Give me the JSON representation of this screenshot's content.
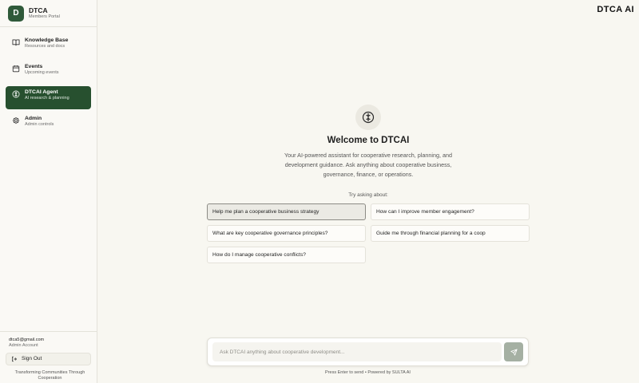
{
  "brand": {
    "logo_letter": "D",
    "title": "DTCA",
    "subtitle": "Members Portal"
  },
  "header": {
    "title": "DTCA AI"
  },
  "nav": {
    "items": [
      {
        "label": "Knowledge Base",
        "desc": "Resources and docs",
        "icon": "book-icon"
      },
      {
        "label": "Events",
        "desc": "Upcoming events",
        "icon": "calendar-icon"
      },
      {
        "label": "DTCAI Agent",
        "desc": "AI research & planning",
        "icon": "brain-icon",
        "active": true
      },
      {
        "label": "Admin",
        "desc": "Admin controls",
        "icon": "gear-icon"
      }
    ]
  },
  "account": {
    "email": "dtca5@gmail.com",
    "role": "Admin Account",
    "signout_label": "Sign Out"
  },
  "tagline": "Transforming Communities Through Cooperation",
  "welcome": {
    "title": "Welcome to DTCAI",
    "description": "Your AI-powered assistant for cooperative research, planning, and development guidance. Ask anything about cooperative business, governance, finance, or operations.",
    "try_label": "Try asking about:"
  },
  "suggestions": [
    "Help me plan a cooperative business strategy",
    "How can I improve member engagement?",
    "What are key cooperative governance principles?",
    "Guide me through financial planning for a coop",
    "How do I manage cooperative conflicts?"
  ],
  "chat": {
    "placeholder": "Ask DTCAI anything about cooperative development...",
    "hint": "Press Enter to send • Powered by SULTA AI"
  },
  "colors": {
    "accent": "#27502f",
    "logo": "#2f5a3a",
    "send_button": "#a5b0a3",
    "background": "#f8f7f1"
  }
}
